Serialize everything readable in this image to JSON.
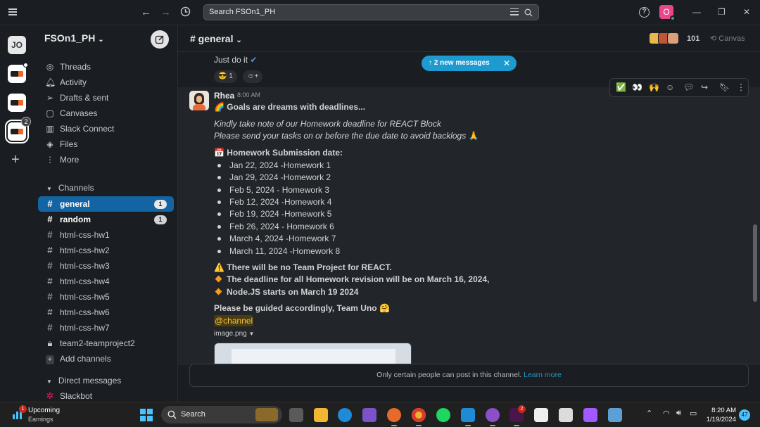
{
  "search": {
    "placeholder": "Search FSOn1_PH"
  },
  "user": {
    "initial": "O"
  },
  "workspaces": [
    {
      "label": "JO"
    },
    {
      "label": ""
    },
    {
      "label": ""
    },
    {
      "label": "",
      "badge": "2"
    }
  ],
  "sidebar": {
    "workspace_name": "FSOn1_PH",
    "nav": [
      {
        "label": "Threads",
        "icon": "threads-icon"
      },
      {
        "label": "Activity",
        "icon": "bell-icon"
      },
      {
        "label": "Drafts & sent",
        "icon": "send-icon"
      },
      {
        "label": "Canvases",
        "icon": "canvas-icon"
      },
      {
        "label": "Slack Connect",
        "icon": "building-icon"
      },
      {
        "label": "Files",
        "icon": "layers-icon"
      },
      {
        "label": "More",
        "icon": "more-icon"
      }
    ],
    "channels_header": "Channels",
    "channels": [
      {
        "name": "general",
        "count": "1"
      },
      {
        "name": "random",
        "count": "1"
      },
      {
        "name": "html-css-hw1"
      },
      {
        "name": "html-css-hw2"
      },
      {
        "name": "html-css-hw3"
      },
      {
        "name": "html-css-hw4"
      },
      {
        "name": "html-css-hw5"
      },
      {
        "name": "html-css-hw6"
      },
      {
        "name": "html-css-hw7"
      },
      {
        "name": "team2-teamproject2"
      }
    ],
    "add_channels": "Add channels",
    "dm_header": "Direct messages",
    "dms": [
      {
        "name": "Slackbot"
      }
    ]
  },
  "channel": {
    "title": "# general",
    "member_count": "101",
    "canvas_label": "Canvas"
  },
  "banner": {
    "label": "2 new messages"
  },
  "previous": {
    "text": "Just do it",
    "reaction_count": "1"
  },
  "message": {
    "author": "Rhea",
    "time": "8:00 AM",
    "headline": "Goals are dreams with deadlines...",
    "intro1": "Kindly take note of our Homework deadline for REACT Block",
    "intro2": "Please send your tasks on or before the due date to avoid backlogs",
    "submission_title": "Homework Submission date:",
    "schedule": [
      "Jan 22, 2024 -Homework 1",
      "Jan 29, 2024 -Homework 2",
      "Feb  5, 2024 - Homework 3",
      "Feb 12, 2024 -Homework 4",
      "Feb 19, 2024 -Homework 5",
      "Feb 26, 2024 - Homework 6",
      "March 4, 2024 -Homework 7",
      "March 11, 2024 -Homework 8"
    ],
    "warning": "There will be no Team Project for REACT.",
    "note1": "The deadline for all Homework revision will be on March 16, 2024,",
    "note2": "Node.JS starts on March 19 2024",
    "closing": "Please be guided accordingly, Team Uno",
    "mention": "@channel",
    "attachment": "image.png"
  },
  "composer": {
    "notice": "Only certain people can post in this channel.",
    "link": "Learn more"
  },
  "taskbar": {
    "weather_badge": "1",
    "weather_title": "Upcoming",
    "weather_sub": "Earnings",
    "search_label": "Search",
    "app_badge": "2",
    "time": "8:20 AM",
    "date": "1/19/2024",
    "notifications": "47"
  }
}
